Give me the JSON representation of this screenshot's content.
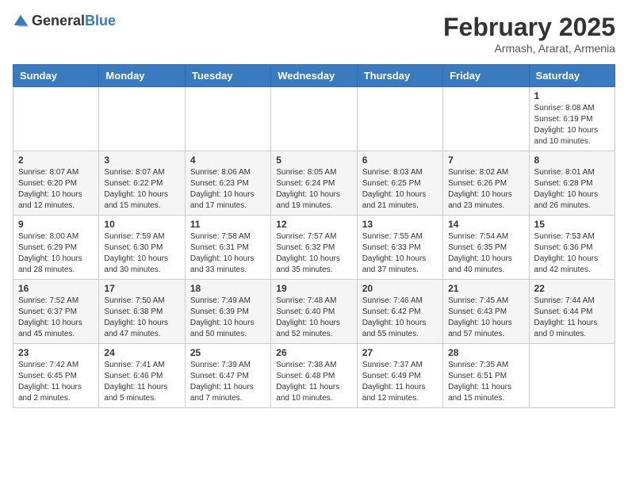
{
  "header": {
    "logo": {
      "general": "General",
      "blue": "Blue"
    },
    "title": "February 2025",
    "location": "Armash, Ararat, Armenia"
  },
  "weekdays": [
    "Sunday",
    "Monday",
    "Tuesday",
    "Wednesday",
    "Thursday",
    "Friday",
    "Saturday"
  ],
  "weeks": [
    [
      {
        "day": "",
        "info": ""
      },
      {
        "day": "",
        "info": ""
      },
      {
        "day": "",
        "info": ""
      },
      {
        "day": "",
        "info": ""
      },
      {
        "day": "",
        "info": ""
      },
      {
        "day": "",
        "info": ""
      },
      {
        "day": "1",
        "info": "Sunrise: 8:08 AM\nSunset: 6:19 PM\nDaylight: 10 hours and 10 minutes."
      }
    ],
    [
      {
        "day": "2",
        "info": "Sunrise: 8:07 AM\nSunset: 6:20 PM\nDaylight: 10 hours and 12 minutes."
      },
      {
        "day": "3",
        "info": "Sunrise: 8:07 AM\nSunset: 6:22 PM\nDaylight: 10 hours and 15 minutes."
      },
      {
        "day": "4",
        "info": "Sunrise: 8:06 AM\nSunset: 6:23 PM\nDaylight: 10 hours and 17 minutes."
      },
      {
        "day": "5",
        "info": "Sunrise: 8:05 AM\nSunset: 6:24 PM\nDaylight: 10 hours and 19 minutes."
      },
      {
        "day": "6",
        "info": "Sunrise: 8:03 AM\nSunset: 6:25 PM\nDaylight: 10 hours and 21 minutes."
      },
      {
        "day": "7",
        "info": "Sunrise: 8:02 AM\nSunset: 6:26 PM\nDaylight: 10 hours and 23 minutes."
      },
      {
        "day": "8",
        "info": "Sunrise: 8:01 AM\nSunset: 6:28 PM\nDaylight: 10 hours and 26 minutes."
      }
    ],
    [
      {
        "day": "9",
        "info": "Sunrise: 8:00 AM\nSunset: 6:29 PM\nDaylight: 10 hours and 28 minutes."
      },
      {
        "day": "10",
        "info": "Sunrise: 7:59 AM\nSunset: 6:30 PM\nDaylight: 10 hours and 30 minutes."
      },
      {
        "day": "11",
        "info": "Sunrise: 7:58 AM\nSunset: 6:31 PM\nDaylight: 10 hours and 33 minutes."
      },
      {
        "day": "12",
        "info": "Sunrise: 7:57 AM\nSunset: 6:32 PM\nDaylight: 10 hours and 35 minutes."
      },
      {
        "day": "13",
        "info": "Sunrise: 7:55 AM\nSunset: 6:33 PM\nDaylight: 10 hours and 37 minutes."
      },
      {
        "day": "14",
        "info": "Sunrise: 7:54 AM\nSunset: 6:35 PM\nDaylight: 10 hours and 40 minutes."
      },
      {
        "day": "15",
        "info": "Sunrise: 7:53 AM\nSunset: 6:36 PM\nDaylight: 10 hours and 42 minutes."
      }
    ],
    [
      {
        "day": "16",
        "info": "Sunrise: 7:52 AM\nSunset: 6:37 PM\nDaylight: 10 hours and 45 minutes."
      },
      {
        "day": "17",
        "info": "Sunrise: 7:50 AM\nSunset: 6:38 PM\nDaylight: 10 hours and 47 minutes."
      },
      {
        "day": "18",
        "info": "Sunrise: 7:49 AM\nSunset: 6:39 PM\nDaylight: 10 hours and 50 minutes."
      },
      {
        "day": "19",
        "info": "Sunrise: 7:48 AM\nSunset: 6:40 PM\nDaylight: 10 hours and 52 minutes."
      },
      {
        "day": "20",
        "info": "Sunrise: 7:46 AM\nSunset: 6:42 PM\nDaylight: 10 hours and 55 minutes."
      },
      {
        "day": "21",
        "info": "Sunrise: 7:45 AM\nSunset: 6:43 PM\nDaylight: 10 hours and 57 minutes."
      },
      {
        "day": "22",
        "info": "Sunrise: 7:44 AM\nSunset: 6:44 PM\nDaylight: 11 hours and 0 minutes."
      }
    ],
    [
      {
        "day": "23",
        "info": "Sunrise: 7:42 AM\nSunset: 6:45 PM\nDaylight: 11 hours and 2 minutes."
      },
      {
        "day": "24",
        "info": "Sunrise: 7:41 AM\nSunset: 6:46 PM\nDaylight: 11 hours and 5 minutes."
      },
      {
        "day": "25",
        "info": "Sunrise: 7:39 AM\nSunset: 6:47 PM\nDaylight: 11 hours and 7 minutes."
      },
      {
        "day": "26",
        "info": "Sunrise: 7:38 AM\nSunset: 6:48 PM\nDaylight: 11 hours and 10 minutes."
      },
      {
        "day": "27",
        "info": "Sunrise: 7:37 AM\nSunset: 6:49 PM\nDaylight: 11 hours and 12 minutes."
      },
      {
        "day": "28",
        "info": "Sunrise: 7:35 AM\nSunset: 6:51 PM\nDaylight: 11 hours and 15 minutes."
      },
      {
        "day": "",
        "info": ""
      }
    ]
  ]
}
